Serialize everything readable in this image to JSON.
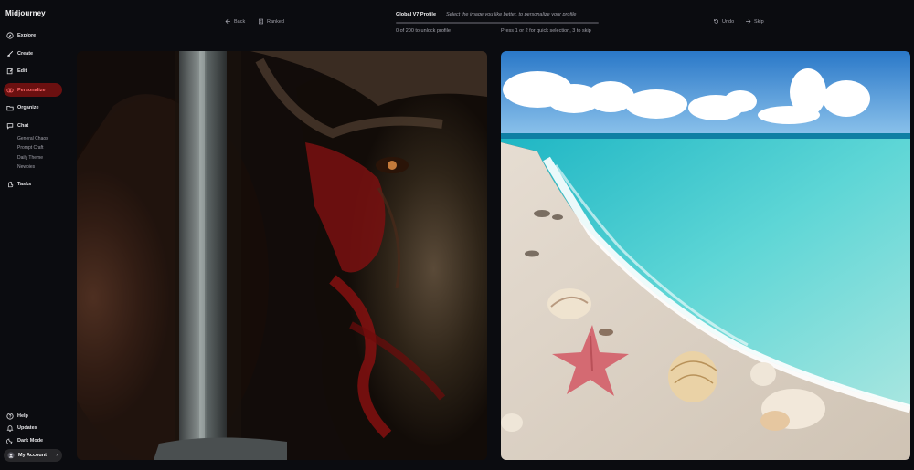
{
  "app": {
    "name": "Midjourney"
  },
  "sidebar": {
    "items": [
      {
        "label": "Explore",
        "icon": "compass-icon"
      },
      {
        "label": "Create",
        "icon": "brush-icon"
      },
      {
        "label": "Edit",
        "icon": "edit-icon"
      },
      {
        "label": "Personalize",
        "icon": "personalize-icon",
        "active": true
      },
      {
        "label": "Organize",
        "icon": "folder-icon"
      },
      {
        "label": "Chat",
        "icon": "chat-icon"
      }
    ],
    "chat_rooms": [
      "General Chaos",
      "Prompt Craft",
      "Daily Theme",
      "Newbies"
    ],
    "tasks_label": "Tasks",
    "bottom": [
      {
        "label": "Help",
        "icon": "help-icon"
      },
      {
        "label": "Updates",
        "icon": "bell-icon"
      },
      {
        "label": "Dark Mode",
        "icon": "moon-icon"
      }
    ],
    "account_label": "My Account"
  },
  "toolbar": {
    "back_label": "Back",
    "ranked_label": "Ranked",
    "undo_label": "Undo",
    "skip_label": "Skip"
  },
  "profile": {
    "title": "Global V7 Profile",
    "hint": "Select the image you like better, to personalize your profile",
    "progress_text": "0 of 200 to unlock profile",
    "progress": 0,
    "key_hint": "Press 1 or 2 for quick selection, 3 to skip"
  },
  "colors": {
    "background": "#0b0c10",
    "active_nav_bg": "#6b1010",
    "active_nav_text": "#ff6b6b"
  },
  "images": [
    {
      "subject": "warrior-with-sword-portrait"
    },
    {
      "subject": "tropical-beach-with-seashells"
    }
  ]
}
